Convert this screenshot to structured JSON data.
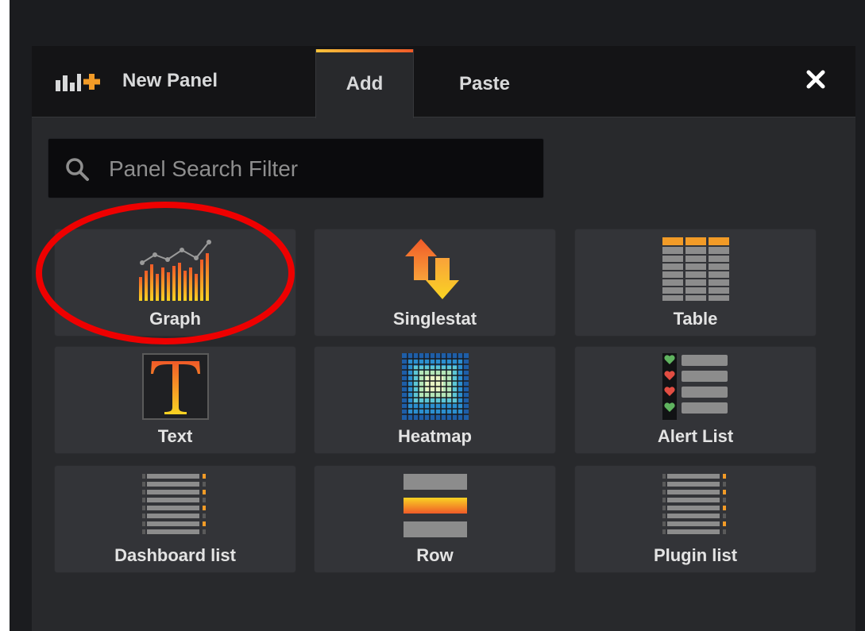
{
  "header": {
    "title": "New Panel",
    "logo_icon": "panel-add-icon",
    "close_icon": "close-icon",
    "accent_gradient": [
      "#f9c23a",
      "#f05a28"
    ]
  },
  "tabs": [
    {
      "label": "Add",
      "active": true
    },
    {
      "label": "Paste",
      "active": false
    }
  ],
  "search": {
    "placeholder": "Panel Search Filter",
    "value": "",
    "icon": "search-icon"
  },
  "panels": [
    {
      "label": "Graph",
      "icon": "graph-icon"
    },
    {
      "label": "Singlestat",
      "icon": "singlestat-icon"
    },
    {
      "label": "Table",
      "icon": "table-icon"
    },
    {
      "label": "Text",
      "icon": "text-icon"
    },
    {
      "label": "Heatmap",
      "icon": "heatmap-icon"
    },
    {
      "label": "Alert List",
      "icon": "alert-list-icon"
    },
    {
      "label": "Dashboard list",
      "icon": "dashboard-list-icon"
    },
    {
      "label": "Row",
      "icon": "row-icon"
    },
    {
      "label": "Plugin list",
      "icon": "plugin-list-icon"
    }
  ],
  "annotation": {
    "shape": "ellipse",
    "color": "#ee0000",
    "target": "Graph"
  }
}
